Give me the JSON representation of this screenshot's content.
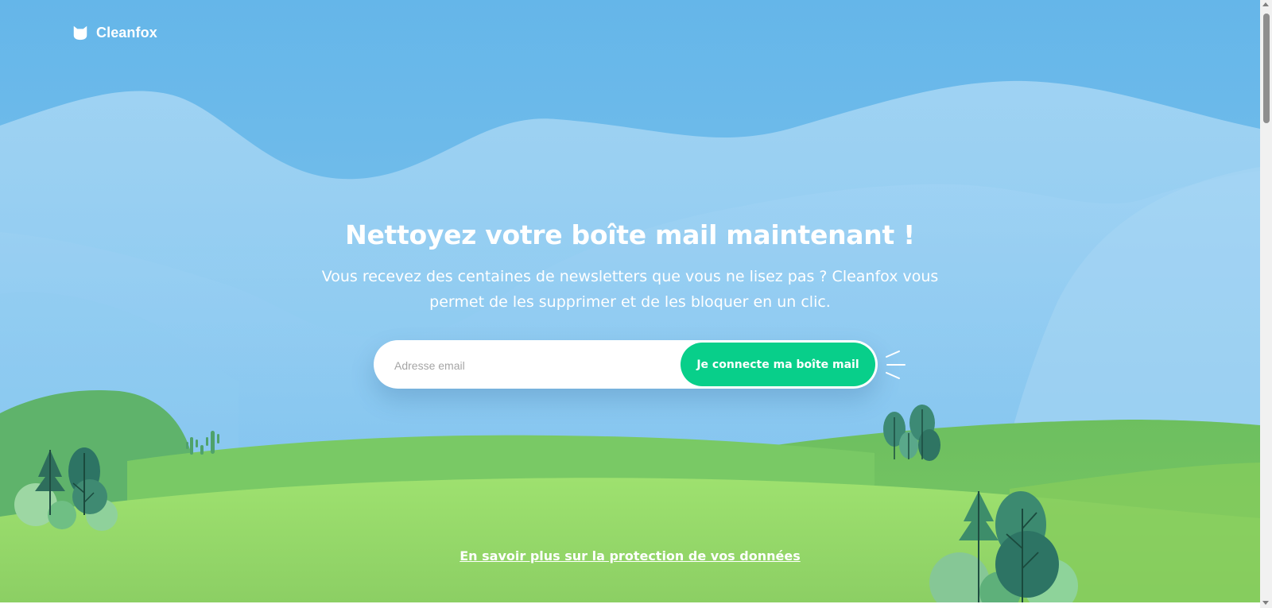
{
  "brand": {
    "name": "Cleanfox",
    "logo_icon": "fox-head-icon"
  },
  "hero": {
    "title": "Nettoyez votre boîte mail maintenant !",
    "subtitle": "Vous recevez des centaines de newsletters que vous ne lisez pas ? Cleanfox vous permet de les supprimer et de les bloquer en un clic."
  },
  "signup": {
    "email_placeholder": "Adresse email",
    "email_value": "",
    "connect_label": "Je connecte ma boîte mail"
  },
  "footer": {
    "privacy_link": "En savoir plus sur la protection de vos données"
  },
  "colors": {
    "sky": "#65b6e9",
    "accent_button": "#08cf8a",
    "text": "#ffffff",
    "hill_green": "#8fd46a",
    "tree_dark": "#2d7464"
  },
  "icons": [
    "fox-head-icon",
    "sparkle-lines-icon",
    "tree-icon",
    "cactus-icon"
  ]
}
